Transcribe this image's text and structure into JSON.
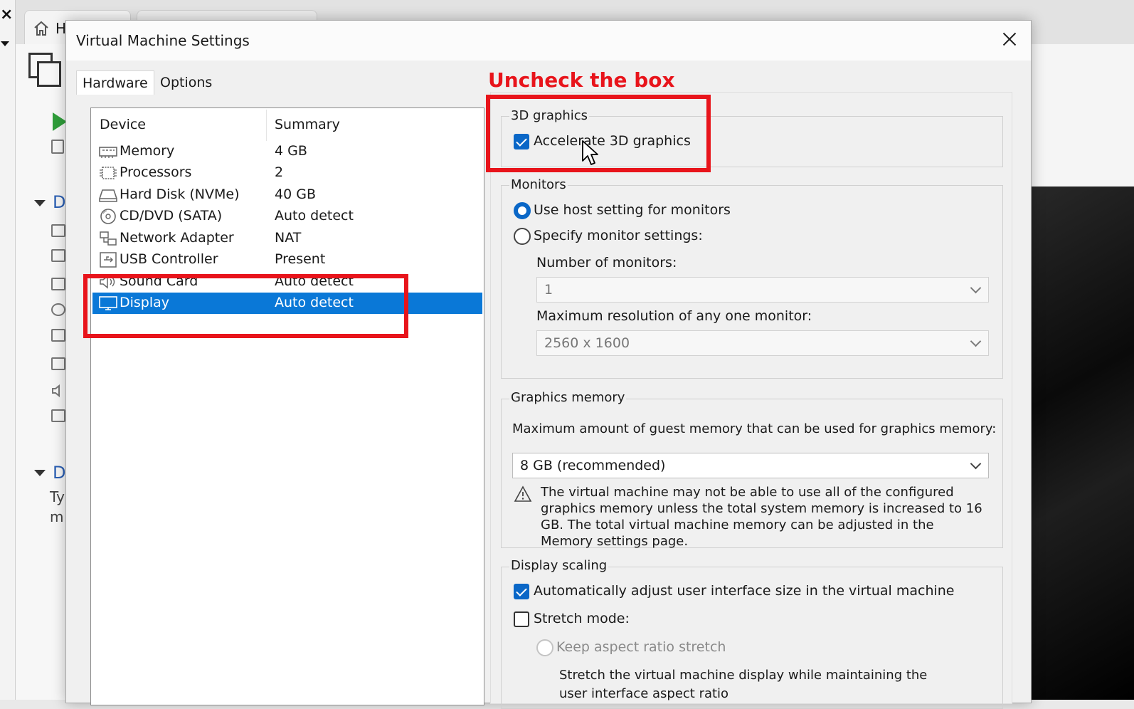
{
  "background": {
    "tab_label": "H",
    "sidebar_sections": [
      "D",
      "D"
    ],
    "sidebar_text": [
      "Ty",
      "m"
    ]
  },
  "dialog": {
    "title": "Virtual Machine Settings",
    "tabs": [
      {
        "label": "Hardware",
        "active": true
      },
      {
        "label": "Options",
        "active": false
      }
    ]
  },
  "devices": {
    "columns": [
      "Device",
      "Summary"
    ],
    "rows": [
      {
        "icon": "memory-icon",
        "name": "Memory",
        "summary": "4 GB"
      },
      {
        "icon": "processor-icon",
        "name": "Processors",
        "summary": "2"
      },
      {
        "icon": "hard-disk-icon",
        "name": "Hard Disk (NVMe)",
        "summary": "40 GB"
      },
      {
        "icon": "cd-dvd-icon",
        "name": "CD/DVD (SATA)",
        "summary": "Auto detect"
      },
      {
        "icon": "network-adapter-icon",
        "name": "Network Adapter",
        "summary": "NAT"
      },
      {
        "icon": "usb-icon",
        "name": "USB Controller",
        "summary": "Present"
      },
      {
        "icon": "sound-card-icon",
        "name": "Sound Card",
        "summary": "Auto detect"
      },
      {
        "icon": "display-icon",
        "name": "Display",
        "summary": "Auto detect",
        "selected": true
      }
    ]
  },
  "graphics3d": {
    "group_title": "3D graphics",
    "accelerate_label": "Accelerate 3D graphics",
    "accelerate_checked": true
  },
  "monitors": {
    "group_title": "Monitors",
    "use_host_label": "Use host setting for monitors",
    "specify_label": "Specify monitor settings:",
    "selected": "use_host",
    "num_monitors_label": "Number of monitors:",
    "num_monitors_value": "1",
    "max_res_label": "Maximum resolution of any one monitor:",
    "max_res_value": "2560 x 1600"
  },
  "graphics_memory": {
    "group_title": "Graphics memory",
    "description": "Maximum amount of guest memory that can be used for graphics memory:",
    "value": "8 GB (recommended)",
    "warning": "The virtual machine may not be able to use all of the configured graphics memory unless the total system memory is increased to 16 GB. The total virtual machine memory can be adjusted in the Memory settings page."
  },
  "display_scaling": {
    "group_title": "Display scaling",
    "auto_adjust_label": "Automatically adjust user interface size in the virtual machine",
    "auto_adjust_checked": true,
    "stretch_label": "Stretch mode:",
    "stretch_checked": false,
    "keep_aspect_label": "Keep aspect ratio stretch",
    "keep_aspect_desc": "Stretch the virtual machine display while maintaining the user interface aspect ratio"
  },
  "annotation": {
    "text": "Uncheck the box",
    "color": "#e8141b"
  },
  "colors": {
    "selection": "#0a78d7",
    "checkbox": "#0a67c7"
  }
}
